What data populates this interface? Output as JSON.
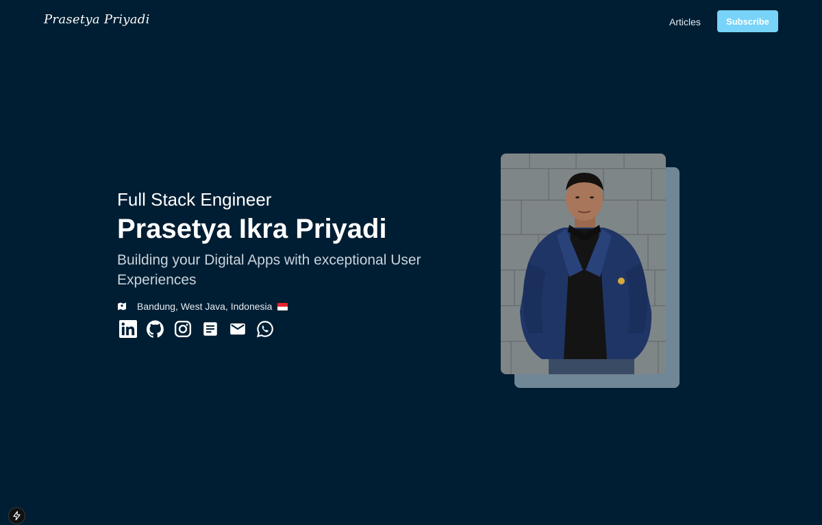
{
  "header": {
    "brand": "Prasetya Priyadi",
    "nav": {
      "articles": "Articles"
    },
    "subscribe_label": "Subscribe"
  },
  "hero": {
    "role": "Full Stack Engineer",
    "name": "Prasetya Ikra Priyadi",
    "tagline": "Building your Digital Apps with exceptional User Experiences",
    "location": "Bandung, West Java, Indonesia",
    "socials": [
      {
        "icon": "linkedin-icon"
      },
      {
        "icon": "github-icon"
      },
      {
        "icon": "instagram-icon"
      },
      {
        "icon": "article-icon"
      },
      {
        "icon": "email-icon"
      },
      {
        "icon": "whatsapp-icon"
      }
    ]
  },
  "colors": {
    "background": "#001e33",
    "accent": "#78d3f8",
    "photo_backdrop": "#6f8796"
  }
}
